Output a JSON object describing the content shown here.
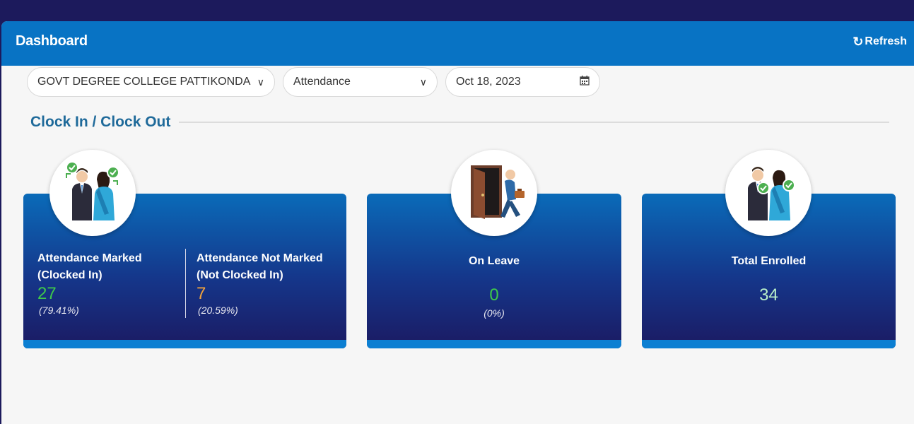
{
  "header": {
    "title": "Dashboard",
    "refresh_label": "Refresh"
  },
  "filters": {
    "college": "GOVT DEGREE COLLEGE PATTIKONDA",
    "type": "Attendance",
    "date": "Oct 18, 2023"
  },
  "section": {
    "title": "Clock In / Clock Out"
  },
  "cards": {
    "marked": {
      "label_line1": "Attendance Marked",
      "label_line2": "(Clocked In)",
      "count": "27",
      "percent": "(79.41%)",
      "count_color": "#3ec94a"
    },
    "not_marked": {
      "label_line1": "Attendance Not Marked",
      "label_line2": "(Not Clocked In)",
      "count": "7",
      "percent": "(20.59%)",
      "count_color": "#f3a33b"
    },
    "leave": {
      "label": "On Leave",
      "count": "0",
      "percent": "(0%)",
      "count_color": "#3ec94a"
    },
    "enrolled": {
      "label": "Total Enrolled",
      "count": "34",
      "count_color": "#b9f0c9"
    }
  },
  "icons": {
    "refresh": "refresh-icon",
    "calendar": "calendar-icon",
    "chevron": "chevron-down-icon",
    "marked": "staff-check-illustration",
    "leave": "person-leaving-door-illustration",
    "enrolled": "staff-pair-illustration"
  }
}
